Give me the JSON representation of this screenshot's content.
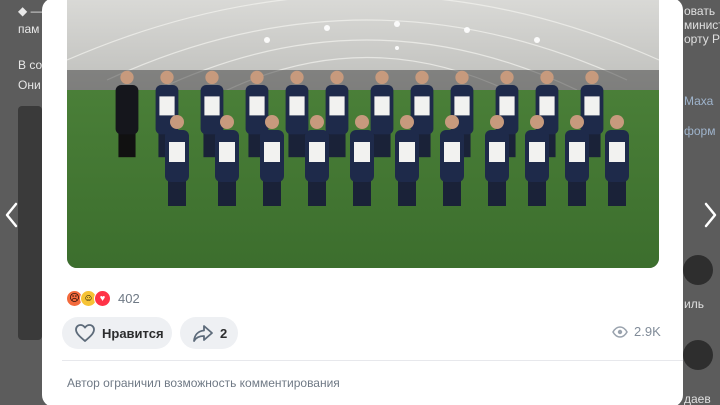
{
  "background": {
    "left_lines": [
      "◆ — В",
      "пам",
      "В со",
      "Они"
    ],
    "right_lines": [
      "овать",
      "минист",
      "орту Р",
      "Маха",
      "форм",
      "иль",
      "даев"
    ]
  },
  "reactions": {
    "icons": [
      "angry-emoji",
      "laughing-emoji",
      "heart-emoji"
    ],
    "count": "402"
  },
  "actions": {
    "like_label": "Нравится",
    "share_count": "2",
    "views": "2.9K"
  },
  "comment_notice": "Автор ограничил возможность комментирования",
  "colors": {
    "accent": "#2688eb",
    "pill_bg": "#eef0f3",
    "muted_text": "#6f7985",
    "turf": "#4f8a3c",
    "kit_navy": "#1e2a4a"
  }
}
